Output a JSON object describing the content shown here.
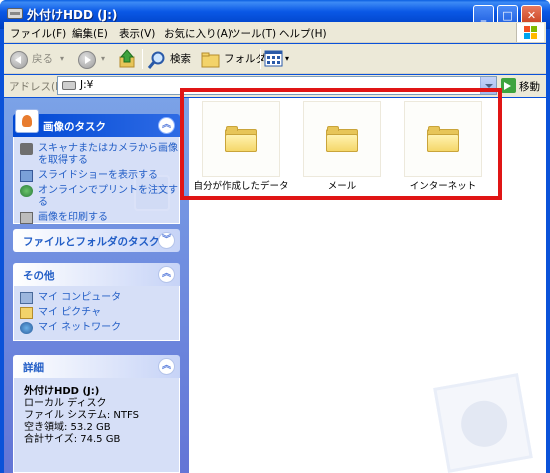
{
  "window": {
    "title": "外付けHDD (J:)"
  },
  "menu": [
    "ファイル(F)",
    "編集(E)",
    "表示(V)",
    "お気に入り(A)",
    "ツール(T)",
    "ヘルプ(H)"
  ],
  "toolbar": {
    "back": "戻る",
    "search": "検索",
    "folders": "フォルダ"
  },
  "address": {
    "label": "アドレス(D)",
    "value": "J:¥",
    "go": "移動"
  },
  "left_panel": {
    "image_tasks": {
      "title": "画像のタスク",
      "items": [
        "スキャナまたはカメラから画像を取得する",
        "スライドショーを表示する",
        "オンラインでプリントを注文する",
        "画像を印刷する"
      ]
    },
    "file_tasks": {
      "title": "ファイルとフォルダのタスク"
    },
    "other": {
      "title": "その他",
      "items": [
        "マイ コンピュータ",
        "マイ ピクチャ",
        "マイ ネットワーク"
      ]
    },
    "details": {
      "title": "詳細",
      "name": "外付けHDD (J:)",
      "type": "ローカル ディスク",
      "filesystem": "ファイル システム: NTFS",
      "free": "空き領域: 53.2 GB",
      "total": "合計サイズ: 74.5 GB"
    }
  },
  "folders": [
    {
      "name": "自分が作成したデータ"
    },
    {
      "name": "メール"
    },
    {
      "name": "インターネット"
    }
  ]
}
